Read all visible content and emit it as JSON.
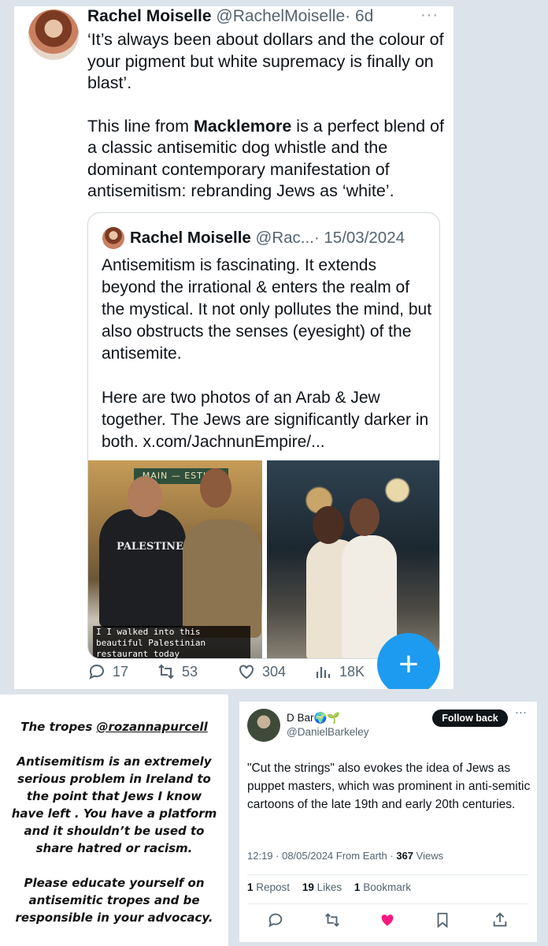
{
  "tweet": {
    "name": "Rachel Moiselle",
    "handle": "@RachelMoiselle",
    "time": "· 6d",
    "more": "···",
    "line1": "‘It’s always been about dollars and the colour of your pigment but white supremacy is finally on blast’.",
    "line2_before": "This line from ",
    "line2_bold": "Macklemore",
    "line2_after": " is a perfect blend of a classic antisemitic dog whistle and the dominant contemporary manifestation of antisemitism: rebranding Jews as ‘white’.",
    "quote": {
      "name": "Rachel Moiselle",
      "handle": "@Rac...",
      "time": "· 15/03/2024",
      "para1": "Antisemitism is fascinating. It extends beyond the irrational & enters the realm of the mystical. It not only pollutes the mind, but also obstructs the senses (eyesight) of the antisemite.",
      "para2": "Here are two photos of an Arab & Jew together. The Jews are significantly darker in both. x.com/JachnunEmpire/...",
      "photo1_sign": "MAIN — ESTINE",
      "photo1_shirt": "PALESTINE",
      "photo1_caption": "I I walked into this beautiful Palestinian restaurant today"
    },
    "actions": {
      "replies": "17",
      "retweets": "53",
      "likes": "304",
      "views": "18K"
    },
    "fab": "+"
  },
  "left_panel": {
    "line1_prefix": "The tropes ",
    "line1_mention": "@rozannapurcell",
    "para2": "Antisemitism is an extremely serious problem in Ireland to the point that Jews I know have left . You have a platform and it shouldn’t be used to share hatred or racism.",
    "para3": "Please educate yourself on antisemitic tropes and be responsible in your advocacy."
  },
  "reply": {
    "name": "D Bar🌍🌱",
    "handle": "@DanielBarkeley",
    "follow_label": "Follow back",
    "more": "···",
    "text": "\"Cut the strings\" also evokes the idea of Jews as puppet masters, which was prominent in anti-semitic cartoons of the late 19th and early 20th centuries.",
    "meta_time": "12:19 · 08/05/2024 From Earth · ",
    "meta_views_count": "367",
    "meta_views_label": " Views",
    "reposts_count": "1",
    "reposts_label": "Repost",
    "likes_count": "19",
    "likes_label": "Likes",
    "bookmarks_count": "1",
    "bookmarks_label": "Bookmark",
    "heart_color": "#f91880"
  }
}
